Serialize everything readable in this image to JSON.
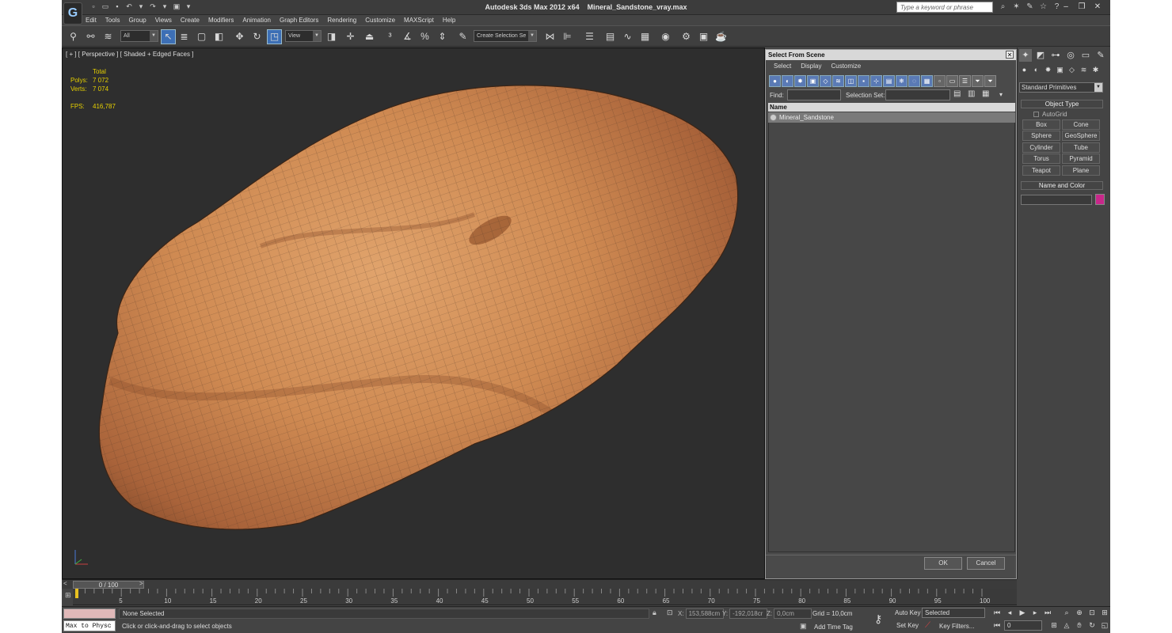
{
  "title_bar": {
    "app": "Autodesk 3ds Max  2012 x64",
    "file": "Mineral_Sandstone_vray.max",
    "search_placeholder": "Type a keyword or phrase"
  },
  "menu": [
    "Edit",
    "Tools",
    "Group",
    "Views",
    "Create",
    "Modifiers",
    "Animation",
    "Graph Editors",
    "Rendering",
    "Customize",
    "MAXScript",
    "Help"
  ],
  "toolbar": {
    "filter": "All",
    "ref_coord": "View",
    "named_selection": "Create Selection Se"
  },
  "viewport": {
    "label": "[ + ] [ Perspective ] [ Shaded + Edged Faces ]",
    "stats_header": "Total",
    "polys_label": "Polys:",
    "polys_value": "7 072",
    "verts_label": "Verts:",
    "verts_value": "7 074",
    "fps_label": "FPS:",
    "fps_value": "416,787"
  },
  "select_dialog": {
    "title": "Select From Scene",
    "menu": [
      "Select",
      "Display",
      "Customize"
    ],
    "find_label": "Find:",
    "selection_set_label": "Selection Set:",
    "column_name": "Name",
    "objects": [
      "Mineral_Sandstone"
    ],
    "ok": "OK",
    "cancel": "Cancel"
  },
  "command_panel": {
    "category": "Standard Primitives",
    "object_type_title": "Object Type",
    "autogrid": "AutoGrid",
    "buttons": [
      "Box",
      "Cone",
      "Sphere",
      "GeoSphere",
      "Cylinder",
      "Tube",
      "Torus",
      "Pyramid",
      "Teapot",
      "Plane"
    ],
    "name_color_title": "Name and Color",
    "object_color": "#c8278a"
  },
  "timeline": {
    "frame_display": "0 / 100",
    "ticks": [
      "5",
      "10",
      "15",
      "20",
      "25",
      "30",
      "35",
      "40",
      "45",
      "50",
      "55",
      "60",
      "65",
      "70",
      "75",
      "80",
      "85",
      "90",
      "95",
      "100"
    ]
  },
  "status": {
    "listener": "Max to Physc",
    "selection": "None Selected",
    "prompt": "Click or click-and-drag to select objects",
    "x_label": "X:",
    "x_value": "153,588cm",
    "y_label": "Y:",
    "y_value": "-192,018cr",
    "z_label": "Z:",
    "z_value": "0,0cm",
    "grid": "Grid = 10,0cm",
    "add_time_tag": "Add Time Tag",
    "auto_key": "Auto Key",
    "set_key": "Set Key",
    "key_mode": "Selected",
    "key_filters": "Key Filters...",
    "current_frame": "0"
  }
}
